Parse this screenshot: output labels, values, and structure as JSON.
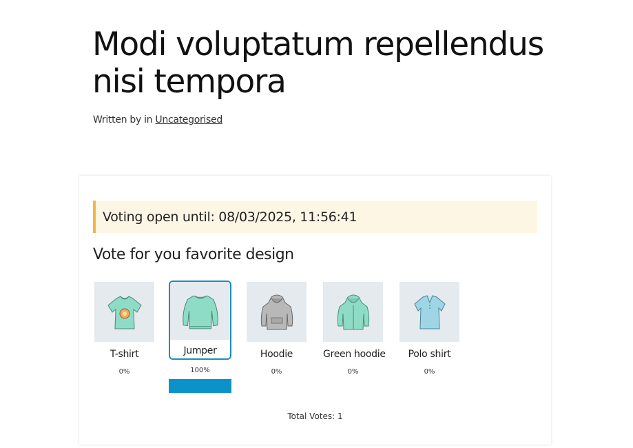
{
  "post": {
    "title": "Modi voluptatum repellendus nisi tempora",
    "byline_prefix": "Written by in ",
    "category": "Uncategorised"
  },
  "poll": {
    "notice": "Voting open until: 08/03/2025, 11:56:41",
    "question": "Vote for you favorite design",
    "options": [
      {
        "label": "T-shirt",
        "percent": "0%",
        "share": 0,
        "selected": false,
        "icon": "tshirt-icon",
        "color": "#8fdcc6"
      },
      {
        "label": "Jumper",
        "percent": "100%",
        "share": 1,
        "selected": true,
        "icon": "jumper-icon",
        "color": "#8fdcc6"
      },
      {
        "label": "Hoodie",
        "percent": "0%",
        "share": 0,
        "selected": false,
        "icon": "hoodie-icon",
        "color": "#b5b5b5"
      },
      {
        "label": "Green hoodie",
        "percent": "0%",
        "share": 0,
        "selected": false,
        "icon": "green-hoodie-icon",
        "color": "#8fdcc6"
      },
      {
        "label": "Polo shirt",
        "percent": "0%",
        "share": 0,
        "selected": false,
        "icon": "polo-shirt-icon",
        "color": "#9fd6e6"
      }
    ],
    "total_votes": "Total Votes: 1",
    "accent_color": "#0b93c9",
    "notice_border_color": "#f4b740"
  }
}
